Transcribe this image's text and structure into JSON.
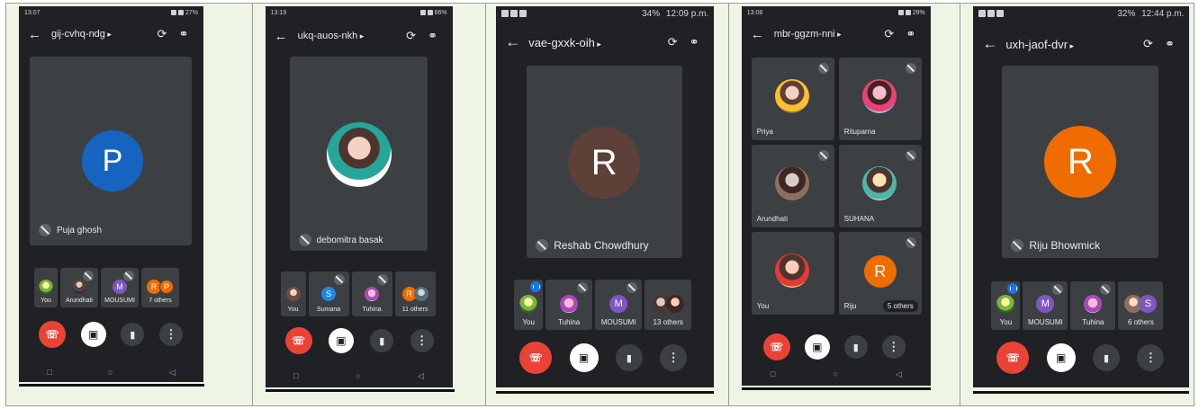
{
  "colors": {
    "end_call": "#ea4335",
    "avatar_blue": "#1565c0",
    "avatar_brown": "#5d4037",
    "avatar_orange": "#ef6c00",
    "avatar_purple": "#7e57c2",
    "avatar_cyan": "#1e88e5",
    "accent_blue": "#1a73e8"
  },
  "icons": {
    "back": "arrow-left-icon",
    "switch_camera": "switch-camera-icon",
    "audio": "headphones-icon",
    "mic_off": "mic-off-icon",
    "end_call": "phone-hangup-icon",
    "camera_off": "camera-off-icon",
    "mic": "mic-icon",
    "more": "more-vert-icon"
  },
  "screens": [
    {
      "status_time": "13:07",
      "status_battery": "27%",
      "meeting_code": "gij-cvhq-ndg",
      "main_initial": "P",
      "main_name": "Puja ghosh",
      "participants": [
        {
          "label": "You",
          "initial": ""
        },
        {
          "label": "Arundhati",
          "initial": ""
        },
        {
          "label": "MOUSUMI",
          "initial": "M"
        },
        {
          "label": "7 others",
          "initial": "R",
          "initial2": "P"
        }
      ]
    },
    {
      "status_time": "13:19",
      "status_battery": "66%",
      "meeting_code": "ukq-auos-nkh",
      "main_name": "debomitra basak",
      "participants": [
        {
          "label": "You",
          "initial": ""
        },
        {
          "label": "Sumana",
          "initial": "S"
        },
        {
          "label": "Tuhina",
          "initial": ""
        },
        {
          "label": "11 others",
          "initial": "R"
        }
      ]
    },
    {
      "status_time": "12:09 p.m.",
      "status_battery": "34%",
      "meeting_code": "vae-gxxk-oih",
      "main_initial": "R",
      "main_name": "Reshab Chowdhury",
      "participants": [
        {
          "label": "You",
          "initial": ""
        },
        {
          "label": "Tuhina",
          "initial": ""
        },
        {
          "label": "MOUSUMI",
          "initial": "M"
        },
        {
          "label": "13 others",
          "initial": ""
        }
      ]
    },
    {
      "status_time": "13:08",
      "status_battery": "29%",
      "meeting_code": "mbr-ggzm-nni",
      "grid": [
        {
          "name": "Priya"
        },
        {
          "name": "Rituparna"
        },
        {
          "name": "Arundhati"
        },
        {
          "name": "SUHANA"
        },
        {
          "name": "You"
        },
        {
          "name": "Riju",
          "initial": "R",
          "others": "5 others"
        }
      ]
    },
    {
      "status_time": "12:44 p.m.",
      "status_battery": "32%",
      "meeting_code": "uxh-jaof-dvr",
      "main_initial": "R",
      "main_name": "Riju Bhowmick",
      "participants": [
        {
          "label": "You",
          "initial": ""
        },
        {
          "label": "MOUSUMI",
          "initial": "M"
        },
        {
          "label": "Tuhina",
          "initial": ""
        },
        {
          "label": "6 others",
          "initial": "S"
        }
      ]
    }
  ]
}
